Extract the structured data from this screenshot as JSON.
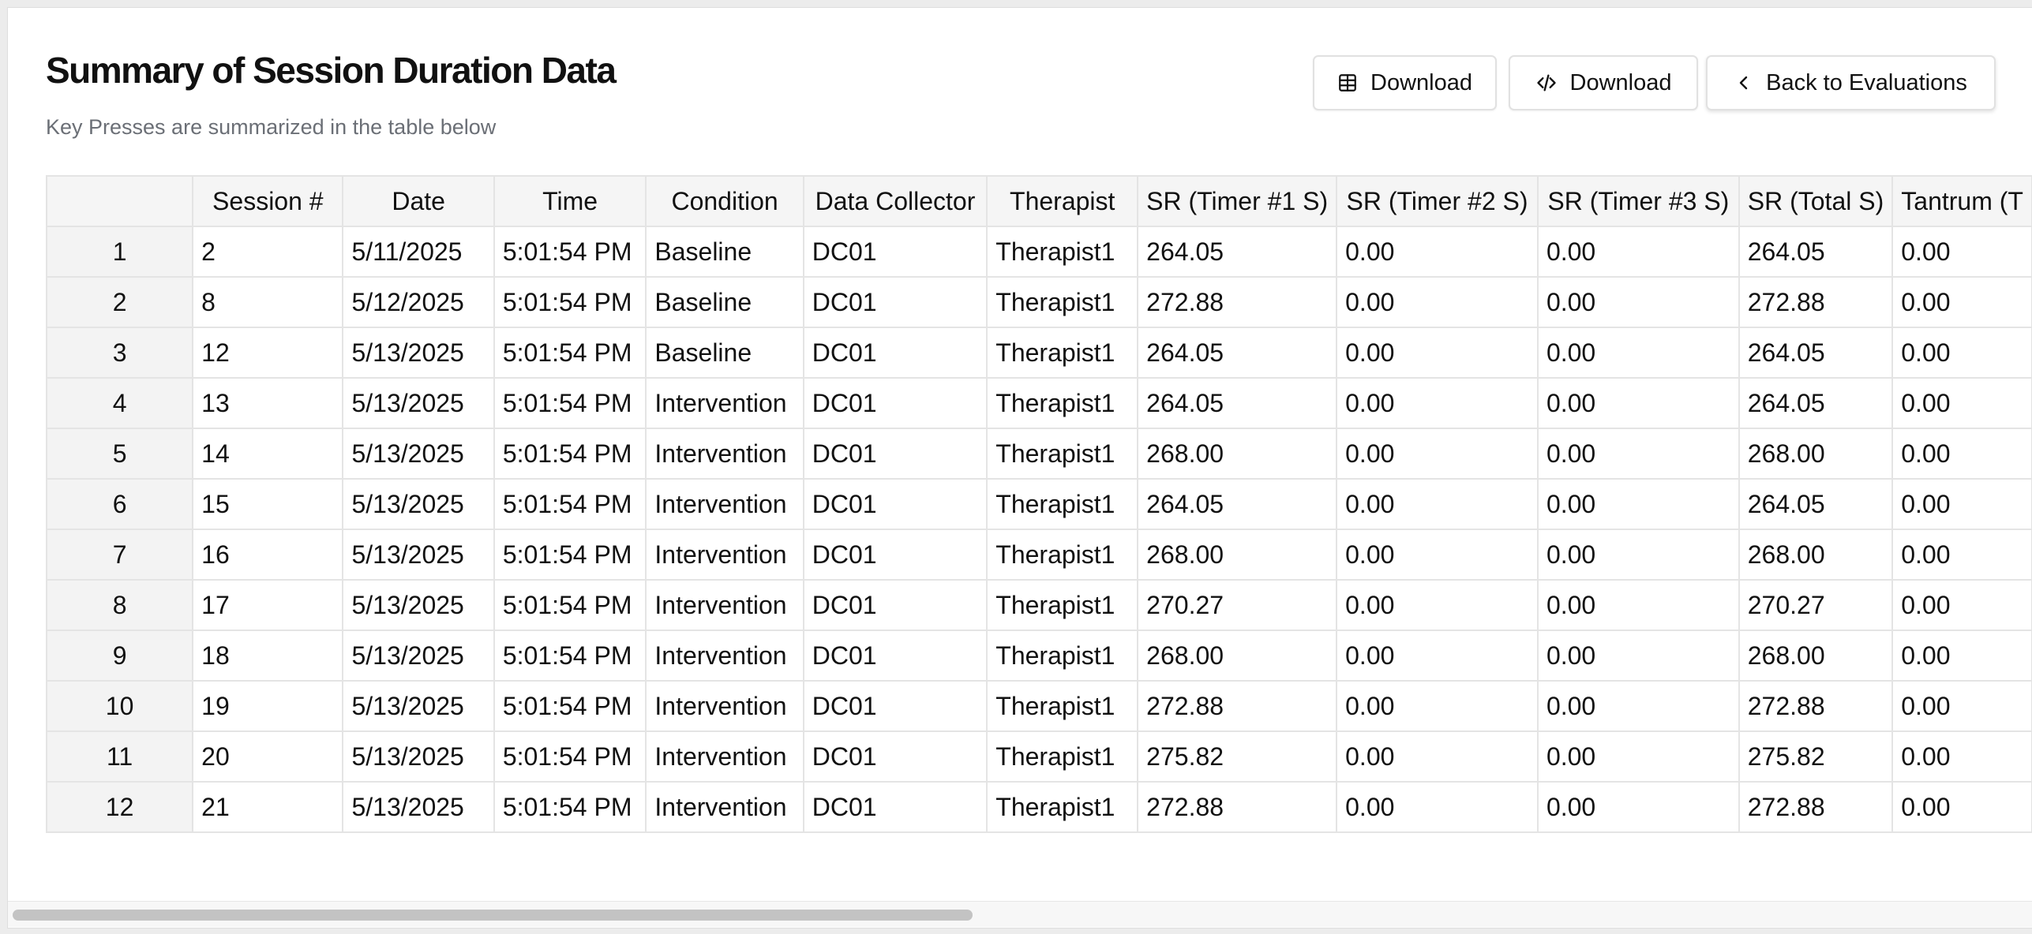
{
  "header": {
    "title": "Summary of Session Duration Data",
    "subtitle": "Key Presses are summarized in the table below"
  },
  "toolbar": {
    "download_csv_label": "Download",
    "download_csv_icon": "table-icon",
    "download_code_label": "Download",
    "download_code_icon": "code-icon",
    "back_label": "Back to Evaluations",
    "back_icon": "chevron-left-icon"
  },
  "table": {
    "columns": [
      "",
      "Session #",
      "Date",
      "Time",
      "Condition",
      "Data Collector",
      "Therapist",
      "SR (Timer #1 S)",
      "SR (Timer #2 S)",
      "SR (Timer #3 S)",
      "SR (Total S)",
      "Tantrum (T"
    ],
    "rows": [
      [
        "1",
        "2",
        "5/11/2025",
        "5:01:54 PM",
        "Baseline",
        "DC01",
        "Therapist1",
        "264.05",
        "0.00",
        "0.00",
        "264.05",
        "0.00"
      ],
      [
        "2",
        "8",
        "5/12/2025",
        "5:01:54 PM",
        "Baseline",
        "DC01",
        "Therapist1",
        "272.88",
        "0.00",
        "0.00",
        "272.88",
        "0.00"
      ],
      [
        "3",
        "12",
        "5/13/2025",
        "5:01:54 PM",
        "Baseline",
        "DC01",
        "Therapist1",
        "264.05",
        "0.00",
        "0.00",
        "264.05",
        "0.00"
      ],
      [
        "4",
        "13",
        "5/13/2025",
        "5:01:54 PM",
        "Intervention",
        "DC01",
        "Therapist1",
        "264.05",
        "0.00",
        "0.00",
        "264.05",
        "0.00"
      ],
      [
        "5",
        "14",
        "5/13/2025",
        "5:01:54 PM",
        "Intervention",
        "DC01",
        "Therapist1",
        "268.00",
        "0.00",
        "0.00",
        "268.00",
        "0.00"
      ],
      [
        "6",
        "15",
        "5/13/2025",
        "5:01:54 PM",
        "Intervention",
        "DC01",
        "Therapist1",
        "264.05",
        "0.00",
        "0.00",
        "264.05",
        "0.00"
      ],
      [
        "7",
        "16",
        "5/13/2025",
        "5:01:54 PM",
        "Intervention",
        "DC01",
        "Therapist1",
        "268.00",
        "0.00",
        "0.00",
        "268.00",
        "0.00"
      ],
      [
        "8",
        "17",
        "5/13/2025",
        "5:01:54 PM",
        "Intervention",
        "DC01",
        "Therapist1",
        "270.27",
        "0.00",
        "0.00",
        "270.27",
        "0.00"
      ],
      [
        "9",
        "18",
        "5/13/2025",
        "5:01:54 PM",
        "Intervention",
        "DC01",
        "Therapist1",
        "268.00",
        "0.00",
        "0.00",
        "268.00",
        "0.00"
      ],
      [
        "10",
        "19",
        "5/13/2025",
        "5:01:54 PM",
        "Intervention",
        "DC01",
        "Therapist1",
        "272.88",
        "0.00",
        "0.00",
        "272.88",
        "0.00"
      ],
      [
        "11",
        "20",
        "5/13/2025",
        "5:01:54 PM",
        "Intervention",
        "DC01",
        "Therapist1",
        "275.82",
        "0.00",
        "0.00",
        "275.82",
        "0.00"
      ],
      [
        "12",
        "21",
        "5/13/2025",
        "5:01:54 PM",
        "Intervention",
        "DC01",
        "Therapist1",
        "272.88",
        "0.00",
        "0.00",
        "272.88",
        "0.00"
      ]
    ]
  }
}
